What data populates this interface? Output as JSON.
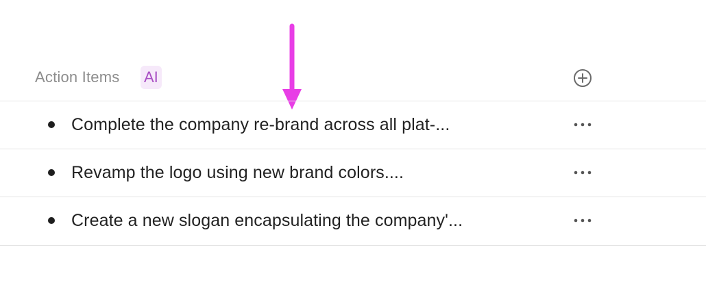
{
  "section": {
    "title": "Action Items",
    "ai_badge": "AI"
  },
  "items": [
    {
      "text": "Complete the company re-brand across all plat-..."
    },
    {
      "text": "Revamp the logo using new brand colors...."
    },
    {
      "text": "Create a new slogan encapsulating the company'..."
    }
  ],
  "icons": {
    "annotation_arrow": "down-arrow-icon",
    "add": "plus-circle-icon",
    "more": "more-horizontal-icon"
  },
  "colors": {
    "annotation_arrow": "#e83ee6",
    "ai_badge_text": "#a94fc4",
    "ai_badge_bg": "#f6e9fa",
    "title_text": "#8c8c8c",
    "item_text": "#222222",
    "divider": "#e4e4e4"
  }
}
